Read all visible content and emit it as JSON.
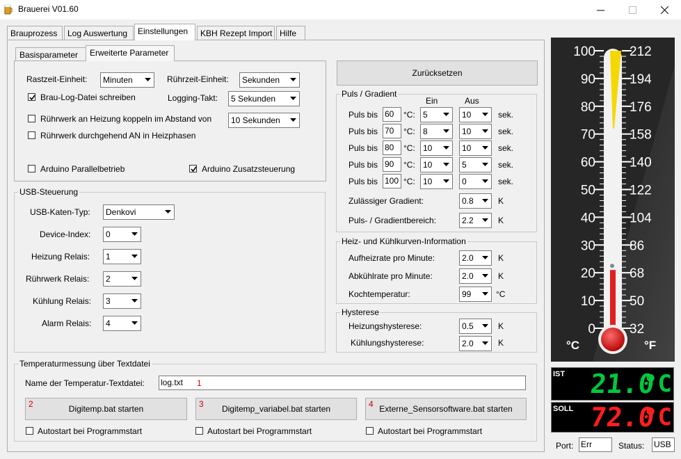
{
  "window": {
    "title": "Brauerei V01.60",
    "icon": "beer-mug-icon",
    "buttons": [
      "minimize-icon",
      "maximize-icon",
      "close-icon"
    ]
  },
  "tabs": [
    {
      "label": "Brauprozess"
    },
    {
      "label": "Log Auswertung"
    },
    {
      "label": "Einstellungen"
    },
    {
      "label": "KBH Rezept Import"
    },
    {
      "label": "Hilfe"
    }
  ],
  "subtabs": [
    {
      "label": "Basisparameter"
    },
    {
      "label": "Erweiterte Parameter"
    }
  ],
  "erweiterte": {
    "rastzeit_label": "Rastzeit-Einheit:",
    "rastzeit_value": "Minuten",
    "ruehrzeit_label": "Rührzeit-Einheit:",
    "ruehrzeit_value": "Sekunden",
    "braulog_label": "Brau-Log-Datei schreiben",
    "logging_label": "Logging-Takt:",
    "logging_value": "5 Sekunden",
    "ruehr_koppeln_label": "Rührwerk an Heizung koppeln im Abstand von",
    "ruehr_koppeln_value": "10 Sekunden",
    "ruehr_durchgehend_label": "Rührwerk durchgehend AN in Heizphasen",
    "arduino_parallel_label": "Arduino Parallelbetrieb",
    "arduino_zusatz_label": "Arduino Zusatzsteuerung"
  },
  "usb": {
    "title": "USB-Steuerung",
    "katen_typ_label": "USB-Katen-Typ:",
    "katen_typ_value": "Denkovi",
    "device_index_label": "Device-Index:",
    "device_index_value": "0",
    "heizung_label": "Heizung Relais:",
    "heizung_value": "1",
    "ruehrwerk_label": "Rührwerk Relais:",
    "ruehrwerk_value": "2",
    "kuehlung_label": "Kühlung Relais:",
    "kuehlung_value": "3",
    "alarm_label": "Alarm Relais:",
    "alarm_value": "4"
  },
  "reset_button": "Zurücksetzen",
  "puls": {
    "title": "Puls / Gradient",
    "ein_header": "Ein",
    "aus_header": "Aus",
    "puls_bis": "Puls bis",
    "unit_c": "°C:",
    "unit_sek": "sek.",
    "rows": [
      {
        "temp": "60",
        "ein": "5",
        "aus": "10"
      },
      {
        "temp": "70",
        "ein": "8",
        "aus": "10"
      },
      {
        "temp": "80",
        "ein": "10",
        "aus": "10"
      },
      {
        "temp": "90",
        "ein": "10",
        "aus": "5"
      },
      {
        "temp": "100",
        "ein": "10",
        "aus": "0"
      }
    ],
    "gradient_label": "Zulässiger Gradient:",
    "gradient_value": "0.8",
    "bereich_label": "Puls- / Gradientbereich:",
    "bereich_value": "2.2",
    "unit_k": "K"
  },
  "heizkurven": {
    "title": "Heiz- und Kühlkurven-Information",
    "aufheiz_label": "Aufheizrate pro Minute:",
    "aufheiz_value": "2.0",
    "abkuehl_label": "Abkühlrate pro Minute:",
    "abkuehl_value": "2.0",
    "koch_label": "Kochtemperatur:",
    "koch_value": "99",
    "unit_k": "K",
    "unit_c": "°C"
  },
  "hysterese": {
    "title": "Hysterese",
    "heizung_label": "Heizungshysterese:",
    "heizung_value": "0.5",
    "kuehlung_label": "Kühlungshysterese:",
    "kuehlung_value": "2.0",
    "unit_k": "K"
  },
  "textdatei": {
    "title": "Temperaturmessung über Textdatei",
    "name_label": "Name der Temperatur-Textdatei:",
    "name_value": "log.txt",
    "marker_1": "1",
    "buttons": [
      {
        "marker": "2",
        "label": "Digitemp.bat starten"
      },
      {
        "marker": "3",
        "label": "Digitemp_variabel.bat starten"
      },
      {
        "marker": "4",
        "label": "Externe_Sensorsoftware.bat starten"
      }
    ],
    "autostart_label": "Autostart bei Programmstart"
  },
  "thermometer": {
    "celsius_ticks": [
      "100",
      "90",
      "80",
      "70",
      "60",
      "50",
      "40",
      "30",
      "20",
      "10",
      "0"
    ],
    "fahrenheit_ticks": [
      "212",
      "194",
      "176",
      "158",
      "140",
      "122",
      "104",
      "86",
      "68",
      "50",
      "32"
    ],
    "unit_c": "°C",
    "unit_f": "°F",
    "current_temp_c": 21.0,
    "target_temp_c": 72.0,
    "colors": {
      "mercury": "#e02020",
      "target": "#f5d800",
      "panel": "#262626"
    }
  },
  "ist": {
    "label": "IST",
    "value": "21.0",
    "unit": "°C",
    "color": "#00c83c"
  },
  "soll": {
    "label": "SOLL",
    "value": "72.0",
    "unit": "°C",
    "color": "#ff1e1e"
  },
  "status_bar": {
    "port_label": "Port:",
    "port_value": "Err",
    "status_label": "Status:",
    "status_value": "USB"
  }
}
